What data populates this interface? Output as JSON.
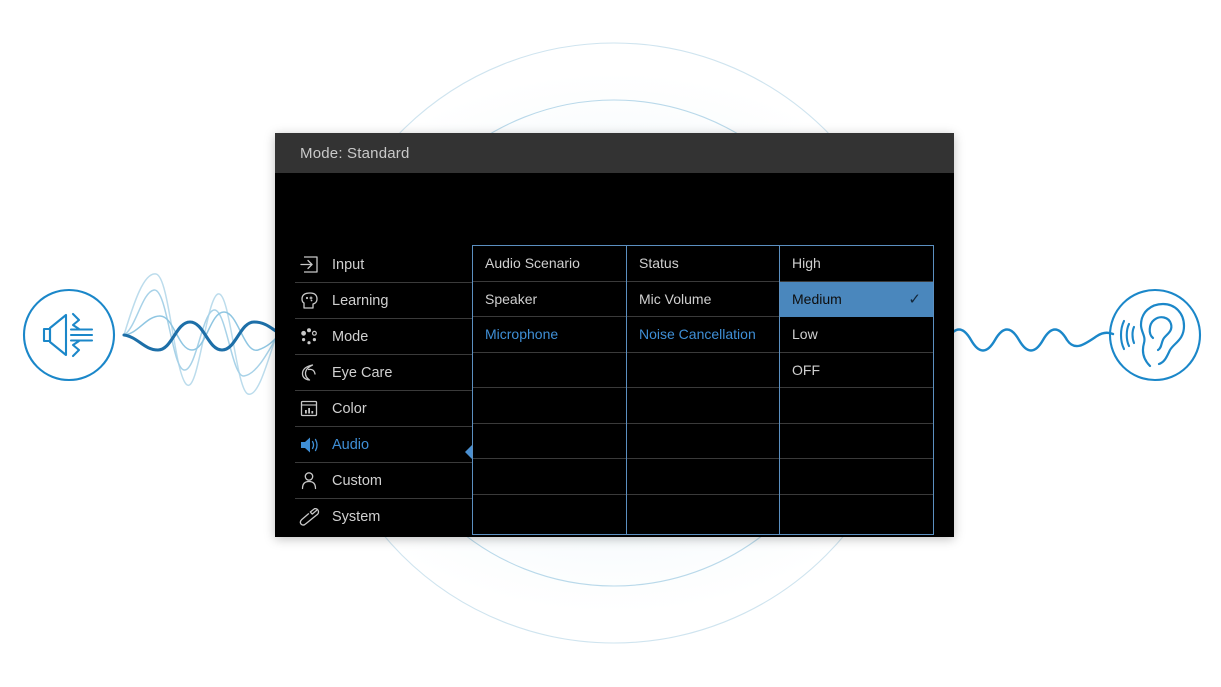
{
  "monitor": {
    "titlebar": {
      "text": "Mode: Standard"
    },
    "sidebar": {
      "items": [
        {
          "label": "Input",
          "icon": "input-arrow-icon",
          "active": false
        },
        {
          "label": "Learning",
          "icon": "head-sparkle-icon",
          "active": false
        },
        {
          "label": "Mode",
          "icon": "dots-circle-icon",
          "active": false
        },
        {
          "label": "Eye Care",
          "icon": "crescent-eye-icon",
          "active": false
        },
        {
          "label": "Color",
          "icon": "display-bars-icon",
          "active": false
        },
        {
          "label": "Audio",
          "icon": "speaker-wave-icon",
          "active": true
        },
        {
          "label": "Custom",
          "icon": "person-icon",
          "active": false
        },
        {
          "label": "System",
          "icon": "wrench-icon",
          "active": false
        }
      ]
    },
    "columns": [
      {
        "name": "audio-scenario-column",
        "rows": [
          {
            "label": "Audio Scenario",
            "state": "normal"
          },
          {
            "label": "Speaker",
            "state": "normal"
          },
          {
            "label": "Microphone",
            "state": "accent"
          },
          {
            "label": "",
            "state": "blank"
          },
          {
            "label": "",
            "state": "blank"
          },
          {
            "label": "",
            "state": "blank"
          },
          {
            "label": "",
            "state": "blank"
          },
          {
            "label": "",
            "state": "blank"
          }
        ]
      },
      {
        "name": "microphone-options-column",
        "rows": [
          {
            "label": "Status",
            "state": "normal"
          },
          {
            "label": "Mic Volume",
            "state": "normal"
          },
          {
            "label": "Noise Cancellation",
            "state": "accent"
          },
          {
            "label": "",
            "state": "blank"
          },
          {
            "label": "",
            "state": "blank"
          },
          {
            "label": "",
            "state": "blank"
          },
          {
            "label": "",
            "state": "blank"
          },
          {
            "label": "",
            "state": "blank"
          }
        ]
      },
      {
        "name": "noise-cancellation-values-column",
        "rows": [
          {
            "label": "High",
            "state": "normal"
          },
          {
            "label": "Medium",
            "state": "selected",
            "check": "✓"
          },
          {
            "label": "Low",
            "state": "normal"
          },
          {
            "label": "OFF",
            "state": "normal"
          },
          {
            "label": "",
            "state": "blank"
          },
          {
            "label": "",
            "state": "blank"
          },
          {
            "label": "",
            "state": "blank"
          },
          {
            "label": "",
            "state": "blank"
          }
        ]
      }
    ]
  },
  "decoration": {
    "left_badge_icon": "speaker-output-icon",
    "right_badge_icon": "ear-listening-icon",
    "left_wave": "complex-audio-waveform",
    "right_wave": "clean-sine-waveform"
  },
  "colors": {
    "accent_blue": "#3f8fd6",
    "selection_blue": "#4a87bd",
    "panel_border": "#5b8fc0",
    "titlebar_bg": "#333333",
    "screen_bg": "#000000",
    "decor_blue": "#1b87c9"
  }
}
